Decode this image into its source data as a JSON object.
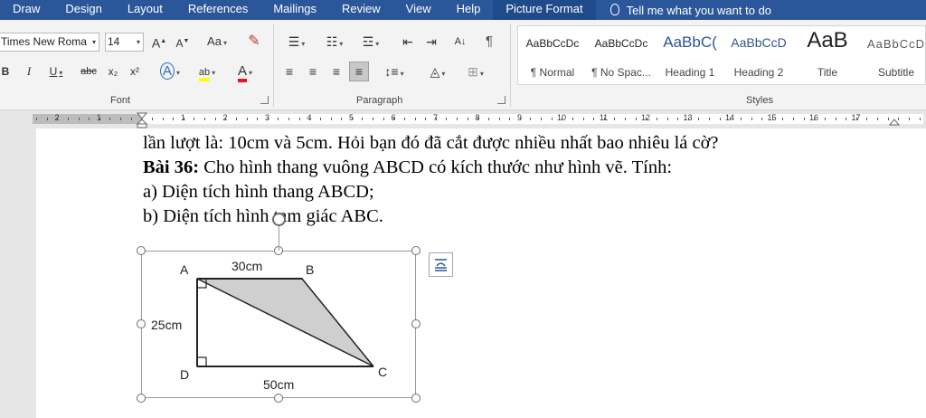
{
  "menu": {
    "tabs": [
      "Draw",
      "Design",
      "Layout",
      "References",
      "Mailings",
      "Review",
      "View",
      "Help",
      "Picture Format"
    ],
    "active_tab": "Picture Format",
    "tell_me": "Tell me what you want to do"
  },
  "ribbon": {
    "font": {
      "name": "Times New Roma",
      "size": "14",
      "grow": "A",
      "shrink": "A",
      "case": "Aa",
      "bold": "B",
      "italic": "I",
      "underline": "U",
      "strike": "abc",
      "subscript": "x₂",
      "superscript": "x²",
      "effects": "A",
      "highlight": "ab",
      "color": "A",
      "label": "Font"
    },
    "paragraph": {
      "label": "Paragraph",
      "show_marks": "¶",
      "sort": "A↓"
    },
    "styles": {
      "label": "Styles",
      "items": [
        {
          "preview": "AaBbCcDc",
          "name": "¶ Normal"
        },
        {
          "preview": "AaBbCcDc",
          "name": "¶ No Spac..."
        },
        {
          "preview": "AaBbC(",
          "name": "Heading 1"
        },
        {
          "preview": "AaBbCcD",
          "name": "Heading 2"
        },
        {
          "preview": "AaB",
          "name": "Title"
        },
        {
          "preview": "AaBbCcD",
          "name": "Subtitle"
        }
      ]
    }
  },
  "ruler": {
    "numbers_left": [
      "2",
      "1"
    ],
    "numbers_right": [
      "1",
      "2",
      "3",
      "4",
      "5",
      "6",
      "7",
      "8",
      "9",
      "10",
      "11",
      "12",
      "13",
      "14",
      "15",
      "16",
      "17"
    ]
  },
  "document": {
    "line1": "lần lượt là: 10cm và 5cm. Hỏi bạn đó đã cắt được nhiều nhất bao nhiêu lá cờ?",
    "line2_bold": "Bài 36:",
    "line2_rest": " Cho hình thang vuông ABCD có kích thước như hình vẽ. Tính:",
    "line3": "a) Diện tích hình thang ABCD;",
    "line4": "b) Diện tích hình tam giác ABC."
  },
  "figure": {
    "points": {
      "A": "A",
      "B": "B",
      "C": "C",
      "D": "D"
    },
    "top_length": "30cm",
    "left_length": "25cm",
    "bottom_length": "50cm",
    "shade_color": "#cfcfcf"
  },
  "colors": {
    "accent": "#2b579a",
    "highlight": "#ffff00",
    "font_color": "#e81123"
  }
}
